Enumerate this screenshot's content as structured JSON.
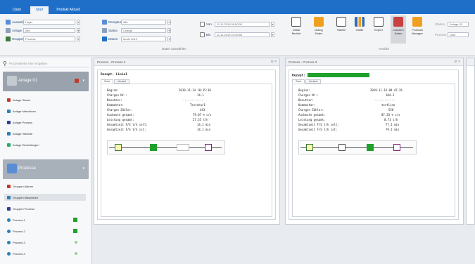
{
  "titlebar": {
    "tabs": [
      "Datei",
      "Start",
      "Produkt Aktuell"
    ]
  },
  "colors": {
    "accent": "#1f6fc9",
    "ok_green": "#1fa12b",
    "sidebar_header": "#9aa3ad"
  },
  "ribbon": {
    "left_rows": [
      {
        "label": "Auswahl",
        "value": "Lager",
        "icon": "folder-icon"
      },
      {
        "label": "Anlage",
        "value": "Alle",
        "icon": "gear-icon"
      },
      {
        "label": "Gruppen",
        "value": "Prozess",
        "icon": "group-icon"
      }
    ],
    "mid_rows": [
      {
        "label": "Rezeptur",
        "value": "Alle",
        "icon": "recipe-icon"
      },
      {
        "label": "Status",
        "value": "Charge",
        "icon": "status-icon"
      },
      {
        "label": "Datum",
        "value": "heute 2019",
        "icon": "clock-icon"
      }
    ],
    "date_rows": [
      {
        "label": "Von",
        "value": "11.11.2019 00:00:00"
      },
      {
        "label": "Bis",
        "value": "11.11.2019 23:59:59"
      }
    ],
    "group_label_left": "Daten auswählen",
    "group_label_right": "Ansicht",
    "buttons": [
      {
        "label": "Detail Bericht",
        "icon": "report-icon"
      },
      {
        "label": "Dialog Daten",
        "icon": "dialog-icon"
      },
      {
        "label": "Tabelle",
        "icon": "table-icon"
      },
      {
        "label": "Grafik",
        "icon": "chart-icon"
      },
      {
        "label": "Export",
        "icon": "export-icon"
      },
      {
        "label": "Löschen Daten",
        "icon": "delete-icon"
      },
      {
        "label": "Protokoll Manager",
        "icon": "protocol-icon"
      }
    ],
    "right_fields": [
      {
        "label": "Station",
        "value": "Anlage 01"
      },
      {
        "label": "Prozess",
        "value": "Linie"
      }
    ]
  },
  "sidebar": {
    "search_placeholder": "Prozesskette hier eingeben",
    "group1_label": "Anlage 01",
    "group1_items": [
      {
        "label": "Anlage Status",
        "icon": "status-icon",
        "color": "#c0392b"
      },
      {
        "label": "Anlage Maschinen",
        "icon": "wrench-icon",
        "color": "#2980b9"
      },
      {
        "label": "Anlage Prozess",
        "icon": "process-icon",
        "color": "#2c3e94"
      },
      {
        "label": "Anlage Variante",
        "icon": "variant-icon",
        "color": "#2980b9"
      },
      {
        "label": "Anlage Einstellungen",
        "icon": "settings-icon",
        "color": "#27ae60"
      }
    ],
    "group2_label": "Prozesse",
    "group2_items": [
      {
        "label": "Gruppen Alarme",
        "icon": "alarm-icon",
        "color": "#c0392b"
      },
      {
        "label": "Gruppen Maschinen",
        "icon": "wrench-icon",
        "color": "#2980b9"
      },
      {
        "label": "Gruppen Prozess",
        "icon": "process-icon",
        "color": "#2c3e94"
      },
      {
        "label": "Prozess 1",
        "icon": "gear-icon",
        "color": "#2980b9"
      },
      {
        "label": "Prozess 2",
        "icon": "gear-icon",
        "color": "#2980b9"
      },
      {
        "label": "Prozess 3",
        "icon": "gear-icon",
        "color": "#2980b9"
      },
      {
        "label": "Prozess 4",
        "icon": "gear-icon",
        "color": "#2980b9"
      }
    ]
  },
  "panels": [
    {
      "title": "Prozess - Prozess 2",
      "rezept_label": "Rezept: Linie1",
      "tabs": [
        "Start",
        "Verlauf"
      ],
      "rows": [
        {
          "k": "Beginn:",
          "v": "2019-11-14 10:35:38"
        },
        {
          "k": "Chargen Nr.:",
          "v": "14.1"
        },
        {
          "k": "Benutzer:",
          "v": "------------"
        },
        {
          "k": "Kommentar:",
          "v": "Testchar1"
        },
        {
          "k": "Chargen Zähler:",
          "v": "443"
        },
        {
          "k": "Ausbeute gesamt:",
          "v": "79.07 % c/s"
        },
        {
          "k": "Leistung gesamt:",
          "v": "27.55 t/h"
        },
        {
          "k": "Gesamtzeit F/S t/h soll:",
          "v": "14.1 min"
        },
        {
          "k": "Gesamtzeit F/S t/h ist:",
          "v": "14.1 min"
        }
      ]
    },
    {
      "title": "Prozess - Prozess 3",
      "rezept_label": "Rezept:",
      "tabs": [
        "Start",
        "Verlauf"
      ],
      "rows": [
        {
          "k": "Beginn:",
          "v": "2019-11-14 09:47:26"
        },
        {
          "k": "Chargen Nr.:",
          "v": "104.3"
        },
        {
          "k": "Benutzer:",
          "v": "------------"
        },
        {
          "k": "Kommentar:",
          "v": "testline"
        },
        {
          "k": "Chargen Zähler:",
          "v": "558"
        },
        {
          "k": "Ausbeute gesamt:",
          "v": "87.33 % c/s"
        },
        {
          "k": "Leistung gesamt:",
          "v": "8.73 t/h"
        },
        {
          "k": "Gesamtzeit F/S t/h soll:",
          "v": "77.1 min"
        },
        {
          "k": "Gesamtzeit F/S t/h ist:",
          "v": "79.1 min"
        }
      ]
    }
  ]
}
